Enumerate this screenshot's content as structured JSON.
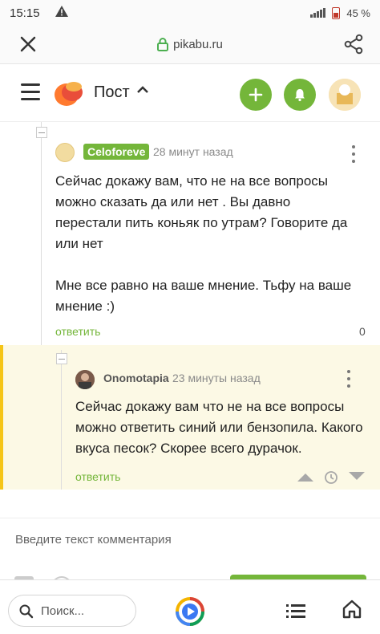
{
  "status_bar": {
    "time": "15:15",
    "battery": "45 %"
  },
  "browser": {
    "domain": "pikabu.ru",
    "search_placeholder": "Поиск..."
  },
  "header": {
    "title": "Пост",
    "accent_color": "#74b63a"
  },
  "comments": [
    {
      "author": "Celoforeve",
      "time": "28 минут назад",
      "paragraphs": [
        "Сейчас докажу вам, что не на все вопросы можно сказать да или нет  . Вы давно перестали пить коньяк по утрам? Говорите да или нет",
        "Мне все равно на ваше мнение. Тьфу на ваше мнение :)"
      ],
      "reply_label": "ответить",
      "reply_count": "0"
    },
    {
      "author": "Onomotapia",
      "time": "23 минуты назад",
      "text": "Сейчас докажу вам что не на все вопросы можно ответить синий или бензопила. Какого вкуса песок? Скорее всего дурачок.",
      "reply_label": "ответить"
    }
  ],
  "composer": {
    "placeholder": "Введите текст комментария"
  }
}
